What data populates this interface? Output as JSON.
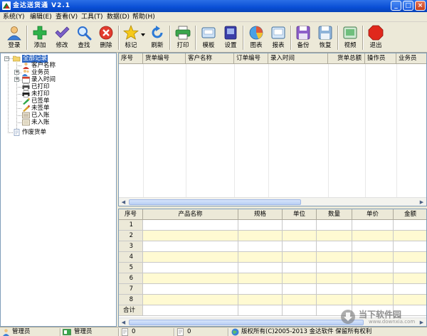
{
  "window": {
    "title": "金达送货通 V2.1",
    "controls": {
      "minimize": "_",
      "maximize": "□",
      "close": "×"
    }
  },
  "menu": [
    "系统(Y)",
    "编辑(E)",
    "查看(V)",
    "工具(T)",
    "数据(D)",
    "帮助(H)"
  ],
  "toolbar": {
    "login": "登录",
    "add": "添加",
    "edit": "修改",
    "find": "查找",
    "delete": "删除",
    "mark": "标记",
    "refresh": "刷新",
    "print": "打印",
    "template": "模板",
    "settings": "设置",
    "chart": "图表",
    "report": "报表",
    "backup": "备份",
    "restore": "恢复",
    "video": "视频",
    "exit": "退出"
  },
  "tree": {
    "root": "全部记录",
    "children": [
      "客户名称",
      "业务员",
      "录入时间",
      "已打印",
      "未打印",
      "已签单",
      "未签单",
      "已入账",
      "未入账"
    ],
    "voided": "作废货单"
  },
  "orders_grid": {
    "columns": [
      "序号",
      "货单编号",
      "客户名称",
      "订单编号",
      "录入时间",
      "货单总额",
      "操作员",
      "业务员"
    ]
  },
  "items_grid": {
    "columns": [
      "序号",
      "产品名称",
      "规格",
      "单位",
      "数量",
      "单价",
      "金额"
    ],
    "row_numbers": [
      "1",
      "2",
      "3",
      "4",
      "5",
      "6",
      "7",
      "8"
    ],
    "total_label": "合计"
  },
  "statusbar": {
    "user_role": "管理员",
    "operator": "管理员",
    "count1": "0",
    "count2": "0",
    "copyright": "版权所有(C)2005-2013 金达软件 保留所有权利"
  },
  "watermark": {
    "text": "当下软件园",
    "url": "www.downxia.com"
  },
  "colors": {
    "titlebar": "#0a4fd6",
    "selection": "#316ac5",
    "row_yellow": "#fffad2"
  }
}
